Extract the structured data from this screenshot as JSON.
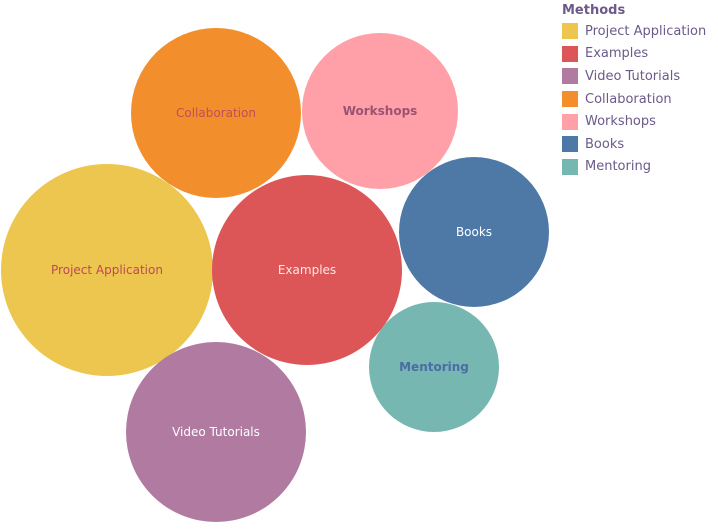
{
  "chart_data": {
    "type": "bubble",
    "legend_title": "Methods",
    "legend_position": "top-right",
    "items": [
      {
        "name": "Project Application",
        "color": "#ecc64f",
        "label_color": "#c0475a",
        "label_weight": "normal",
        "size": 106
      },
      {
        "name": "Examples",
        "color": "#dd5657",
        "label_color": "#fbe7e4",
        "label_weight": "normal",
        "size": 95
      },
      {
        "name": "Video Tutorials",
        "color": "#b07aa1",
        "label_color": "#ffffff",
        "label_weight": "normal",
        "size": 90
      },
      {
        "name": "Collaboration",
        "color": "#f28e2b",
        "label_color": "#c24d5a",
        "label_weight": "normal",
        "size": 85
      },
      {
        "name": "Workshops",
        "color": "#ffa0a8",
        "label_color": "#9a5273",
        "label_weight": "bold",
        "size": 78
      },
      {
        "name": "Books",
        "color": "#4e79a7",
        "label_color": "#ffffff",
        "label_weight": "normal",
        "size": 75
      },
      {
        "name": "Mentoring",
        "color": "#76b7b2",
        "label_color": "#4a6da3",
        "label_weight": "bold",
        "size": 65
      }
    ]
  }
}
